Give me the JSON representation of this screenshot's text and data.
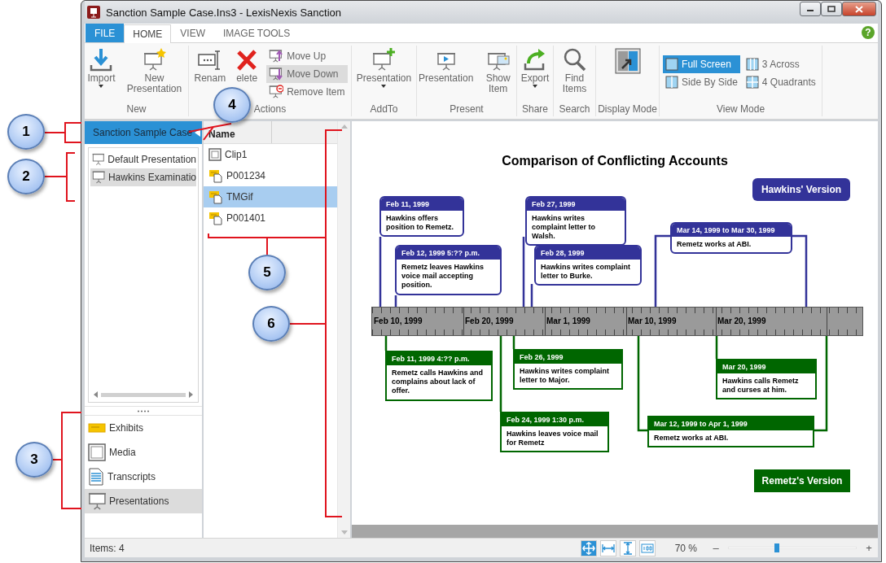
{
  "window": {
    "title": "Sanction Sample Case.Ins3 - LexisNexis Sanction"
  },
  "ribbon": {
    "tabs": [
      {
        "label": "FILE",
        "kind": "file",
        "selected": false
      },
      {
        "label": "HOME",
        "kind": "tab",
        "selected": true
      },
      {
        "label": "VIEW",
        "kind": "tab",
        "selected": false
      },
      {
        "label": "IMAGE TOOLS",
        "kind": "tab",
        "selected": false
      }
    ],
    "help": "?",
    "groups": [
      {
        "label": "New",
        "buttons": [
          {
            "label": "Import",
            "kind": "import",
            "dropdown": true
          },
          {
            "label": "New Presentation",
            "kind": "new-presentation",
            "dropdown": false
          }
        ]
      },
      {
        "label": "Actions",
        "buttons": [
          {
            "label": "Renam",
            "kind": "rename",
            "dropdown": false
          },
          {
            "label": "elete",
            "kind": "delete",
            "dropdown": false
          }
        ],
        "small_buttons": [
          {
            "label": "Move Up",
            "kind": "move-up",
            "selected": false
          },
          {
            "label": "Move Down",
            "kind": "move-down",
            "selected": true
          },
          {
            "label": "Remove Item",
            "kind": "remove",
            "selected": false
          }
        ]
      },
      {
        "label": "AddTo",
        "buttons": [
          {
            "label": "Presentation",
            "kind": "add-presentation",
            "dropdown": true
          }
        ]
      },
      {
        "label": "Present",
        "buttons": [
          {
            "label": "Presentation",
            "kind": "present",
            "dropdown": false
          },
          {
            "label": "Show Item",
            "kind": "show-item",
            "dropdown": false
          }
        ]
      },
      {
        "label": "Share",
        "buttons": [
          {
            "label": "Export",
            "kind": "export",
            "dropdown": true
          }
        ]
      },
      {
        "label": "Search",
        "buttons": [
          {
            "label": "Find Items",
            "kind": "find",
            "dropdown": false
          }
        ]
      },
      {
        "label": "Display Mode",
        "buttons": [
          {
            "kind": "display"
          }
        ]
      },
      {
        "label": "View Mode",
        "small_buttons": [
          {
            "label": "Full Screen",
            "kind": "full",
            "selected": true
          },
          {
            "label": "Side By Side",
            "kind": "side",
            "selected": false
          },
          {
            "label": "3 Across",
            "kind": "three",
            "selected": false
          },
          {
            "label": "4 Quadrants",
            "kind": "four",
            "selected": false
          }
        ]
      }
    ]
  },
  "case_panel": {
    "title": "Sanction Sample Case",
    "presentations": [
      {
        "label": "Default Presentation",
        "selected": false
      },
      {
        "label": "Hawkins Examinatio",
        "selected": true
      }
    ],
    "nav": [
      {
        "label": "Exhibits",
        "kind": "exhibits",
        "selected": false
      },
      {
        "label": "Media",
        "kind": "media",
        "selected": false
      },
      {
        "label": "Transcripts",
        "kind": "transcripts",
        "selected": false
      },
      {
        "label": "Presentations",
        "kind": "presentations",
        "selected": true
      }
    ]
  },
  "items_panel": {
    "column": "Name",
    "items": [
      {
        "label": "Clip1",
        "kind": "clip",
        "selected": false
      },
      {
        "label": "P001234",
        "kind": "exhibit",
        "selected": false
      },
      {
        "label": "TMGif",
        "kind": "exhibit",
        "selected": true
      },
      {
        "label": "P001401",
        "kind": "exhibit",
        "selected": false
      }
    ]
  },
  "viewer": {
    "title": "Comparison of Conflicting Accounts",
    "legends": [
      {
        "label": "Hawkins' Version",
        "color": "#333399"
      },
      {
        "label": "Remetz's Version",
        "color": "#006600"
      }
    ],
    "timeline": [
      "Feb 10, 1999",
      "Feb 20, 1999",
      "Mar 1, 1999",
      "Mar 10, 1999",
      "Mar 20, 1999"
    ],
    "events": [
      {
        "date": "Feb 11, 1999",
        "text": "Hawkins offers position to Remetz.",
        "color": "#333399"
      },
      {
        "date": "Feb 12, 1999 5:?? p.m.",
        "text": "Remetz leaves Hawkins voice mail accepting position.",
        "color": "#333399"
      },
      {
        "date": "Feb 27, 1999",
        "text": "Hawkins writes complaint letter to Walsh.",
        "color": "#333399"
      },
      {
        "date": "Feb 28, 1999",
        "text": "Hawkins writes complaint letter to Burke.",
        "color": "#333399"
      },
      {
        "date": "Mar 14, 1999 to Mar 30, 1999",
        "text": "Remetz works at ABI.",
        "color": "#333399"
      },
      {
        "date": "Feb 11, 1999 4:?? p.m.",
        "text": "Remetz calls Hawkins and complains about lack of offer.",
        "color": "#006600"
      },
      {
        "date": "Feb 26, 1999",
        "text": "Hawkins writes complaint letter to Major.",
        "color": "#006600"
      },
      {
        "date": "Feb 24, 1999 1:30 p.m.",
        "text": "Hawkins leaves voice mail for Remetz",
        "color": "#006600"
      },
      {
        "date": "Mar 20, 1999",
        "text": "Hawkins calls Remetz and curses at him.",
        "color": "#006600"
      },
      {
        "date": "Mar 12, 1999 to Apr 1, 1999",
        "text": "Remetz works at ABI.",
        "color": "#006600"
      }
    ]
  },
  "status_bar": {
    "items": "Items: 4",
    "view_buttons": [
      {
        "kind": "fit-page",
        "selected": true
      },
      {
        "kind": "fit-width",
        "selected": false
      },
      {
        "kind": "fit-height",
        "selected": false
      },
      {
        "kind": "actual-size",
        "selected": false
      }
    ],
    "zoom": "70 %",
    "minus": "–",
    "plus": "+",
    "level": 0.38
  },
  "callouts": [
    "1",
    "2",
    "3",
    "4",
    "5",
    "6"
  ]
}
